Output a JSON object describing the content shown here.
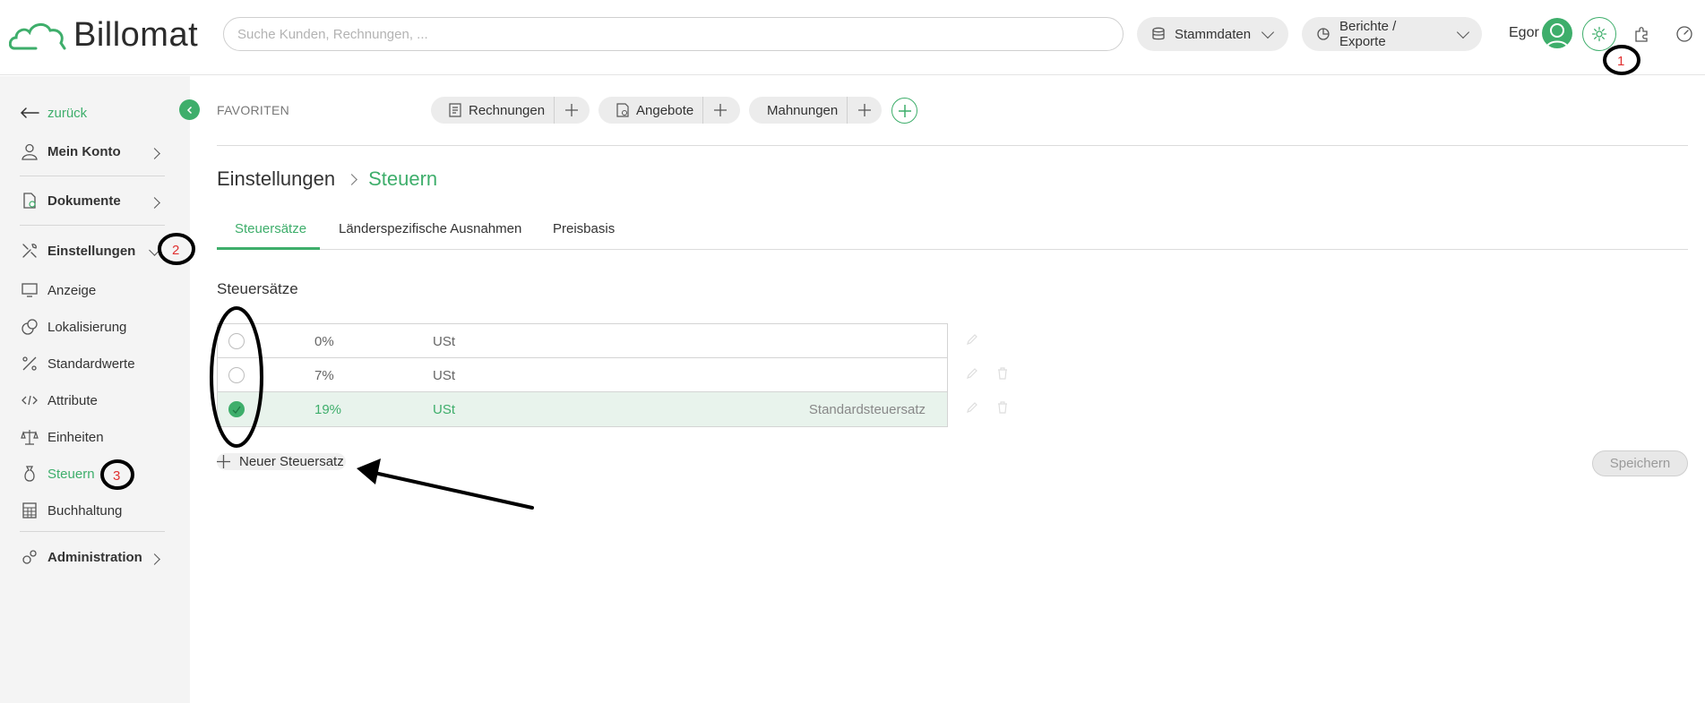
{
  "app": {
    "name": "Billomat"
  },
  "search": {
    "placeholder": "Suche Kunden, Rechnungen, ..."
  },
  "topnav": {
    "master_data": "Stammdaten",
    "reports": "Berichte / Exporte",
    "user": "Egor"
  },
  "sidebar": {
    "back": "zurück",
    "my_account": "Mein Konto",
    "documents": "Dokumente",
    "settings": "Einstellungen",
    "items": [
      "Anzeige",
      "Lokalisierung",
      "Standardwerte",
      "Attribute",
      "Einheiten",
      "Steuern",
      "Buchhaltung"
    ],
    "administration": "Administration"
  },
  "favorites": {
    "label": "FAVORITEN",
    "items": [
      "Rechnungen",
      "Angebote",
      "Mahnungen"
    ]
  },
  "breadcrumb": {
    "parent": "Einstellungen",
    "current": "Steuern"
  },
  "tabs": [
    "Steuersätze",
    "Länderspezifische Ausnahmen",
    "Preisbasis"
  ],
  "section_title": "Steuersätze",
  "tax_rates": [
    {
      "rate": "0%",
      "name": "USt",
      "note": "",
      "selected": false
    },
    {
      "rate": "7%",
      "name": "USt",
      "note": "",
      "selected": false
    },
    {
      "rate": "19%",
      "name": "USt",
      "note": "Standardsteuersatz",
      "selected": true
    }
  ],
  "new_tax_label": "Neuer Steuersatz",
  "save_label": "Speichern",
  "annotations": [
    "1",
    "2",
    "3"
  ],
  "colors": {
    "accent": "#3eae6b",
    "annotation_number": "#e03030"
  }
}
